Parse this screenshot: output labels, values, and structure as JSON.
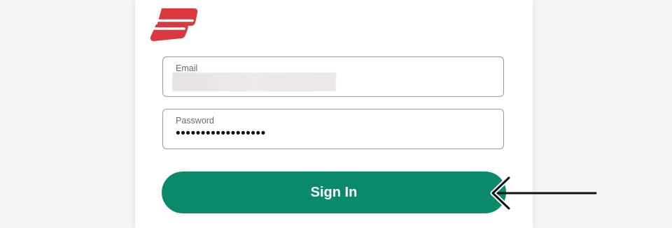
{
  "colors": {
    "brand_red": "#da3940",
    "button_green": "#0b8a6b",
    "field_border": "#9a9a9a",
    "arrow": "#111111"
  },
  "logo": {
    "icon": "expressvpn-logo"
  },
  "form": {
    "email": {
      "label": "Email",
      "value_state": "blurred"
    },
    "password": {
      "label": "Password",
      "value": "••••••••••••••••••"
    },
    "submit_label": "Sign In"
  },
  "annotation": {
    "icon": "arrow-left-icon"
  }
}
